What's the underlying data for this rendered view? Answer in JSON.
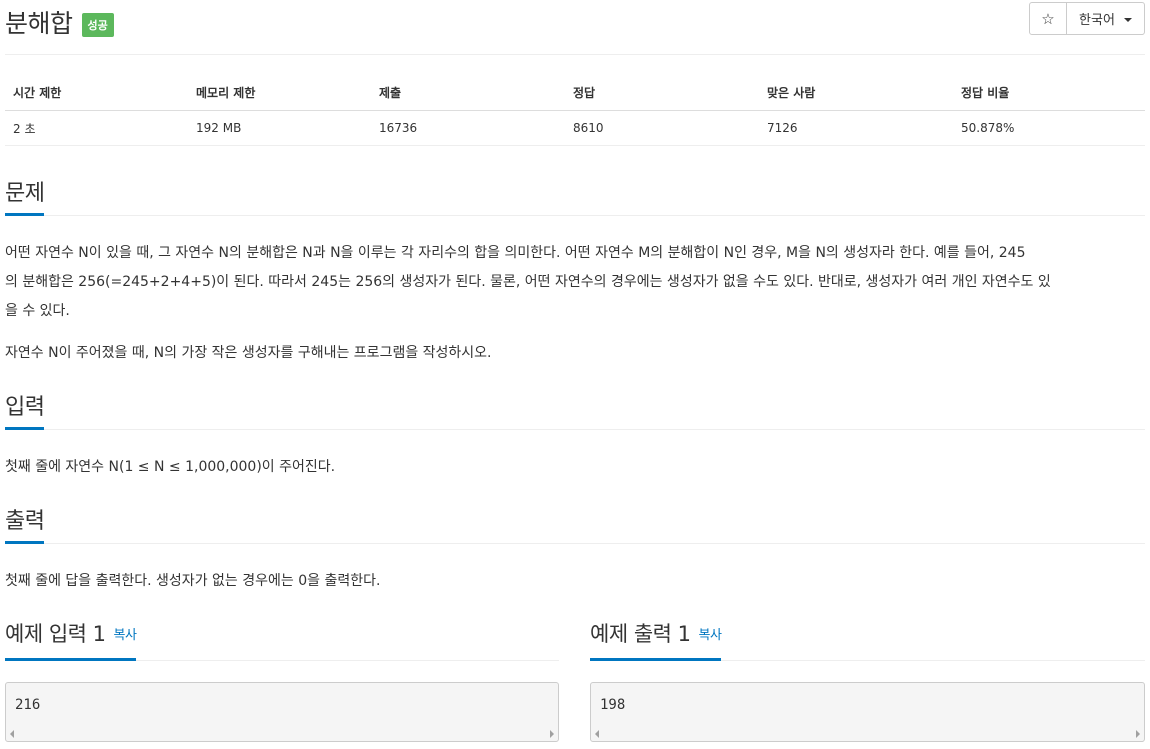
{
  "header": {
    "title": "분해합",
    "badge": "성공",
    "star_icon": "☆",
    "language": "한국어"
  },
  "info_table": {
    "headers": [
      "시간 제한",
      "메모리 제한",
      "제출",
      "정답",
      "맞은 사람",
      "정답 비율"
    ],
    "values": [
      "2 초",
      "192 MB",
      "16736",
      "8610",
      "7126",
      "50.878%"
    ]
  },
  "problem": {
    "heading": "문제",
    "paragraph1_lines": [
      "어떤 자연수 N이 있을 때, 그 자연수 N의 분해합은 N과 N을 이루는 각 자리수의 합을 의미한다. 어떤 자연수 M의 분해합이 N인 경우, M을 N의 생성자라 한다. 예를 들어, 245",
      "의 분해합은 256(=245+2+4+5)이 된다. 따라서 245는 256의 생성자가 된다. 물론, 어떤 자연수의 경우에는 생성자가 없을 수도 있다. 반대로, 생성자가 여러 개인 자연수도 있",
      "을 수 있다."
    ],
    "paragraph2": "자연수 N이 주어졌을 때, N의 가장 작은 생성자를 구해내는 프로그램을 작성하시오."
  },
  "input_section": {
    "heading": "입력",
    "text": "첫째 줄에 자연수 N(1 ≤ N ≤ 1,000,000)이 주어진다."
  },
  "output_section": {
    "heading": "출력",
    "text": "첫째 줄에 답을 출력한다. 생성자가 없는 경우에는 0을 출력한다."
  },
  "examples": {
    "input_heading": "예제 입력 1",
    "output_heading": "예제 출력 1",
    "copy_label": "복사",
    "sample_input": "216",
    "sample_output": "198"
  },
  "colors": {
    "accent": "#0076c0",
    "badge_success": "#5cb85c"
  }
}
